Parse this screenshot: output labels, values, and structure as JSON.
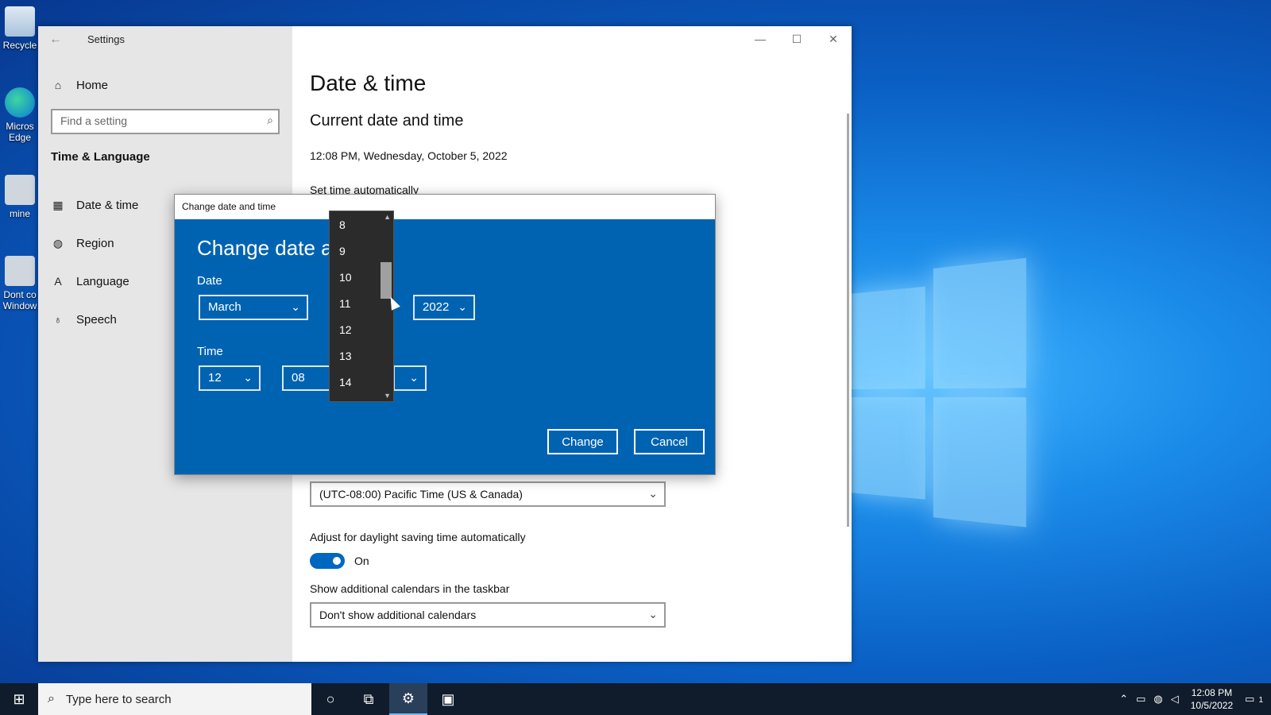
{
  "desktop": {
    "icons": [
      {
        "label": "Recycle"
      },
      {
        "label": "Micros Edge"
      },
      {
        "label": "mine"
      },
      {
        "label": "Dont co Window"
      }
    ]
  },
  "settings": {
    "window_title": "Settings",
    "home_label": "Home",
    "search_placeholder": "Find a setting",
    "section_label": "Time & Language",
    "nav": [
      {
        "label": "Date & time",
        "icon": "calendar-clock-icon"
      },
      {
        "label": "Region",
        "icon": "globe-icon"
      },
      {
        "label": "Language",
        "icon": "language-icon"
      },
      {
        "label": "Speech",
        "icon": "microphone-icon"
      }
    ],
    "page_title": "Date & time",
    "section_title": "Current date and time",
    "current_datetime": "12:08 PM, Wednesday, October 5, 2022",
    "set_time_auto_label": "Set time automatically",
    "timezone_value": "(UTC-08:00) Pacific Time (US & Canada)",
    "dst_label": "Adjust for daylight saving time automatically",
    "dst_toggle_label": "On",
    "calendars_label": "Show additional calendars in the taskbar",
    "calendars_value": "Don't show additional calendars"
  },
  "dialog": {
    "title": "Change date and time",
    "heading": "Change date and",
    "date_label": "Date",
    "month_value": "March",
    "year_value": "2022",
    "time_label": "Time",
    "hour_value": "12",
    "minute_value": "08",
    "day_options": [
      "8",
      "9",
      "10",
      "11",
      "12",
      "13",
      "14"
    ],
    "change_button": "Change",
    "cancel_button": "Cancel"
  },
  "taskbar": {
    "search_placeholder": "Type here to search",
    "time": "12:08 PM",
    "date": "10/5/2022",
    "notification_count": "1"
  }
}
